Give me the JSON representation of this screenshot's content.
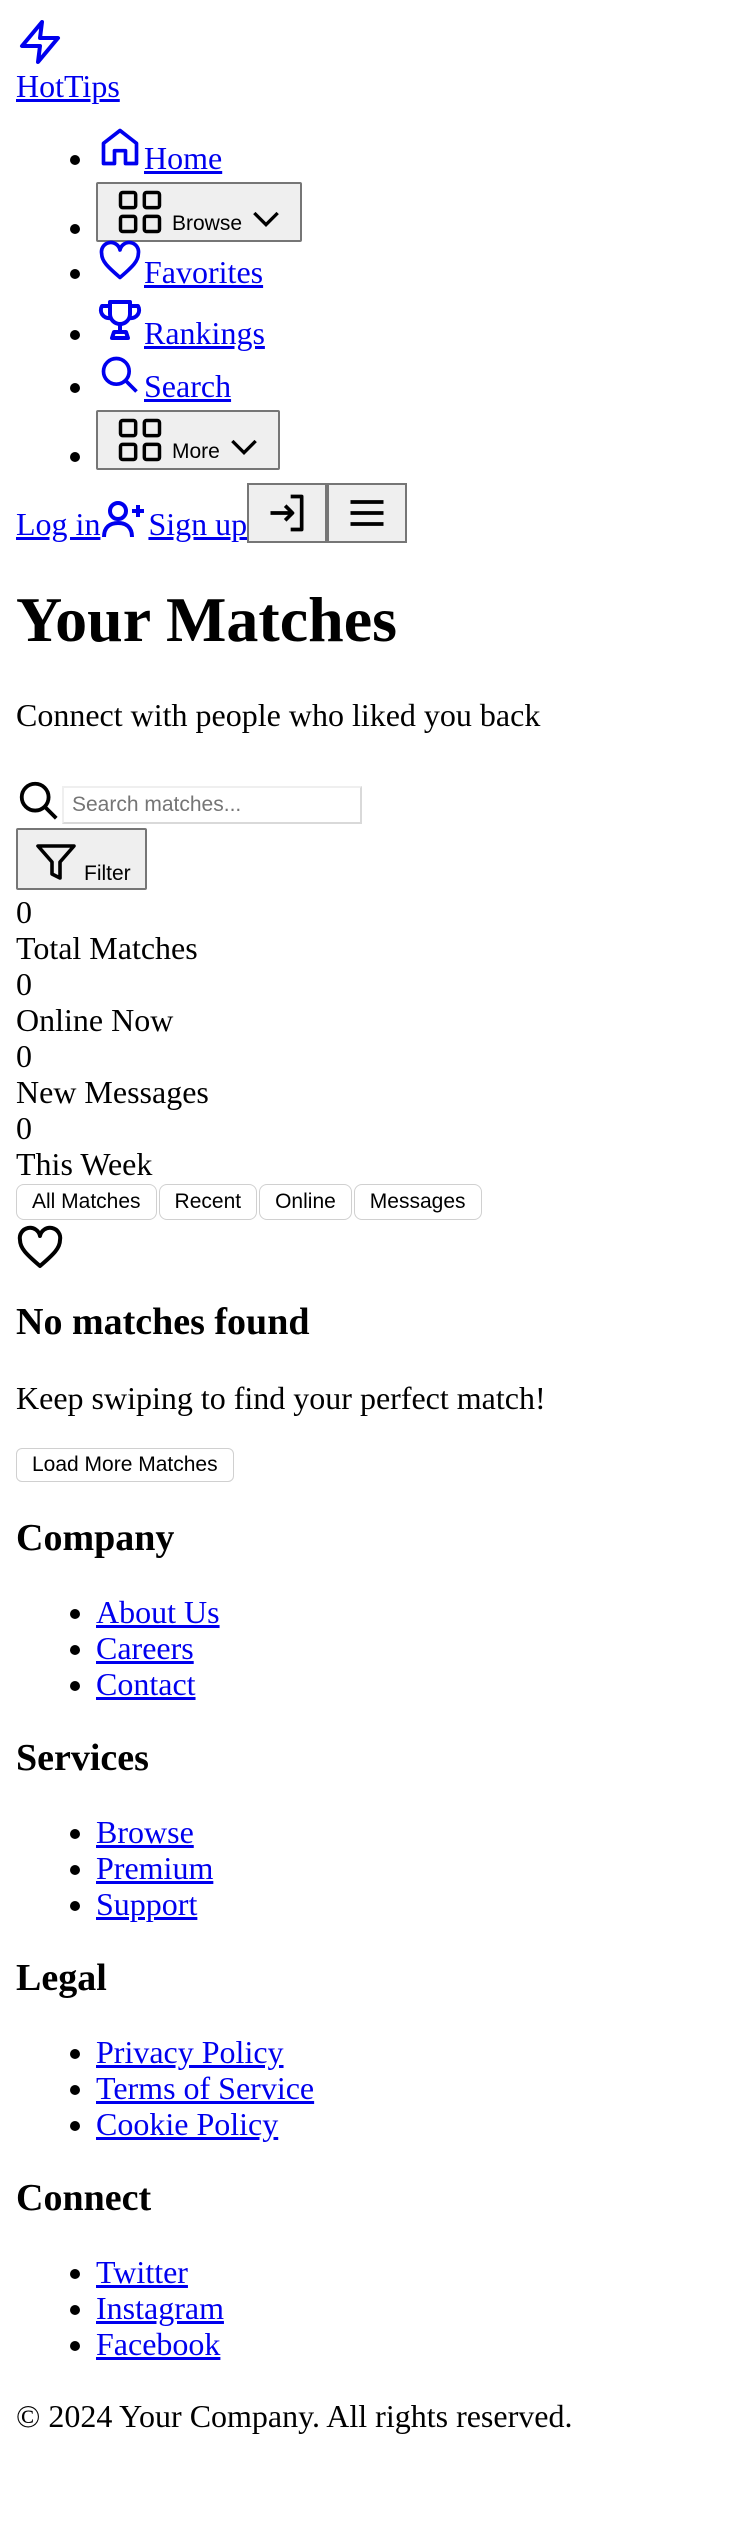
{
  "brand": {
    "name": "HotTips"
  },
  "nav": {
    "items": [
      {
        "label": "Home",
        "type": "link",
        "icon": "home-icon"
      },
      {
        "label": "Browse",
        "type": "button",
        "icon": "grid-icon"
      },
      {
        "label": "Favorites",
        "type": "link",
        "icon": "heart-icon"
      },
      {
        "label": "Rankings",
        "type": "link",
        "icon": "trophy-icon"
      },
      {
        "label": "Search",
        "type": "link",
        "icon": "search-icon"
      },
      {
        "label": "More",
        "type": "button",
        "icon": "grid-icon"
      }
    ]
  },
  "auth": {
    "login_label": "Log in",
    "signup_label": "Sign up"
  },
  "page": {
    "title": "Your Matches",
    "subtitle": "Connect with people who liked you back"
  },
  "search": {
    "placeholder": "Search matches...",
    "filter_label": "Filter"
  },
  "stats": [
    {
      "value": "0",
      "label": "Total Matches"
    },
    {
      "value": "0",
      "label": "Online Now"
    },
    {
      "value": "0",
      "label": "New Messages"
    },
    {
      "value": "0",
      "label": "This Week"
    }
  ],
  "tabs": [
    "All Matches",
    "Recent",
    "Online",
    "Messages"
  ],
  "empty": {
    "title": "No matches found",
    "text": "Keep swiping to find your perfect match!",
    "load_more_label": "Load More Matches"
  },
  "footer": {
    "sections": [
      {
        "title": "Company",
        "links": [
          "About Us",
          "Careers",
          "Contact"
        ]
      },
      {
        "title": "Services",
        "links": [
          "Browse",
          "Premium",
          "Support"
        ]
      },
      {
        "title": "Legal",
        "links": [
          "Privacy Policy",
          "Terms of Service",
          "Cookie Policy"
        ]
      },
      {
        "title": "Connect",
        "links": [
          "Twitter",
          "Instagram",
          "Facebook"
        ]
      }
    ],
    "copyright": "© 2024 Your Company. All rights reserved."
  },
  "colors": {
    "link": "#0000ee",
    "button_bg": "#efefef",
    "button_border": "#767676"
  }
}
